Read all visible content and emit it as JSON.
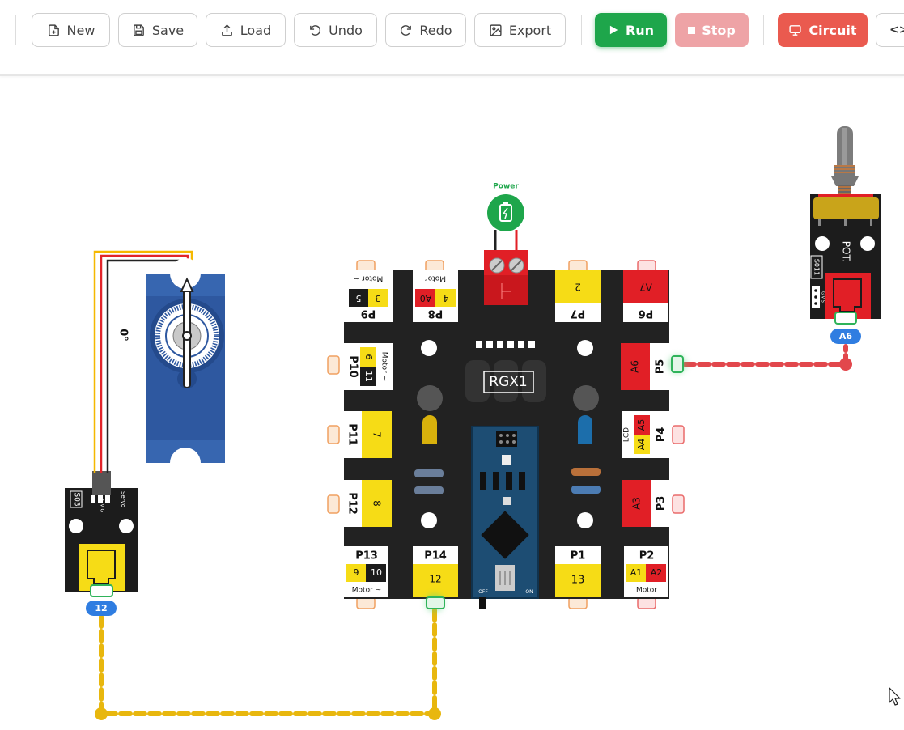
{
  "toolbar": {
    "new_label": "New",
    "save_label": "Save",
    "load_label": "Load",
    "undo_label": "Undo",
    "redo_label": "Redo",
    "export_label": "Export",
    "run_label": "Run",
    "stop_label": "Stop",
    "circuit_label": "Circuit",
    "code_label": "<>"
  },
  "board": {
    "name": "RGX1",
    "power_label": "Power",
    "switch_off": "OFF",
    "switch_on": "ON",
    "ports": {
      "p9": {
        "label": "P9",
        "pin_a": "5",
        "pin_b": "3",
        "sub": "Motor ~"
      },
      "p8": {
        "label": "P8",
        "pin_a": "A0",
        "pin_b": "4",
        "sub": "Motor"
      },
      "p7": {
        "label": "P7",
        "pin": "2"
      },
      "p6": {
        "label": "P6",
        "pin": "A7"
      },
      "p10": {
        "label": "P10",
        "pin_a": "6",
        "pin_b": "11",
        "sub": "Motor ~"
      },
      "p5": {
        "label": "P5",
        "pin": "A6"
      },
      "p11": {
        "label": "P11",
        "pin": "7"
      },
      "p4": {
        "label": "P4",
        "pin_a": "A5",
        "pin_b": "A4",
        "sub": "LCD"
      },
      "p12": {
        "label": "P12",
        "pin": "8"
      },
      "p3": {
        "label": "P3",
        "pin": "A3"
      },
      "p13": {
        "label": "P13",
        "pin_a": "9",
        "pin_b": "10",
        "sub": "Motor ~"
      },
      "p14": {
        "label": "P14",
        "pin": "12"
      },
      "p1": {
        "label": "P1",
        "pin": "13"
      },
      "p2": {
        "label": "P2",
        "pin_a": "A1",
        "pin_b": "A2",
        "sub": "Motor"
      }
    }
  },
  "servo_module": {
    "code": "S03",
    "name": "Servo",
    "pins": "S V G",
    "badge": "12"
  },
  "servo_motor": {
    "angle": "0°"
  },
  "pot_module": {
    "code": "S011",
    "name": "POT.",
    "pins": "G V S",
    "badge": "A6"
  },
  "colors": {
    "board": "#222222",
    "yellow": "#f6dc16",
    "red": "#d9242a",
    "run": "#1ea64b",
    "circuit": "#ea5a4f",
    "wire_yellow": "#e8b70e",
    "wire_red": "#e2474c",
    "badge_blue": "#2f7de1"
  }
}
